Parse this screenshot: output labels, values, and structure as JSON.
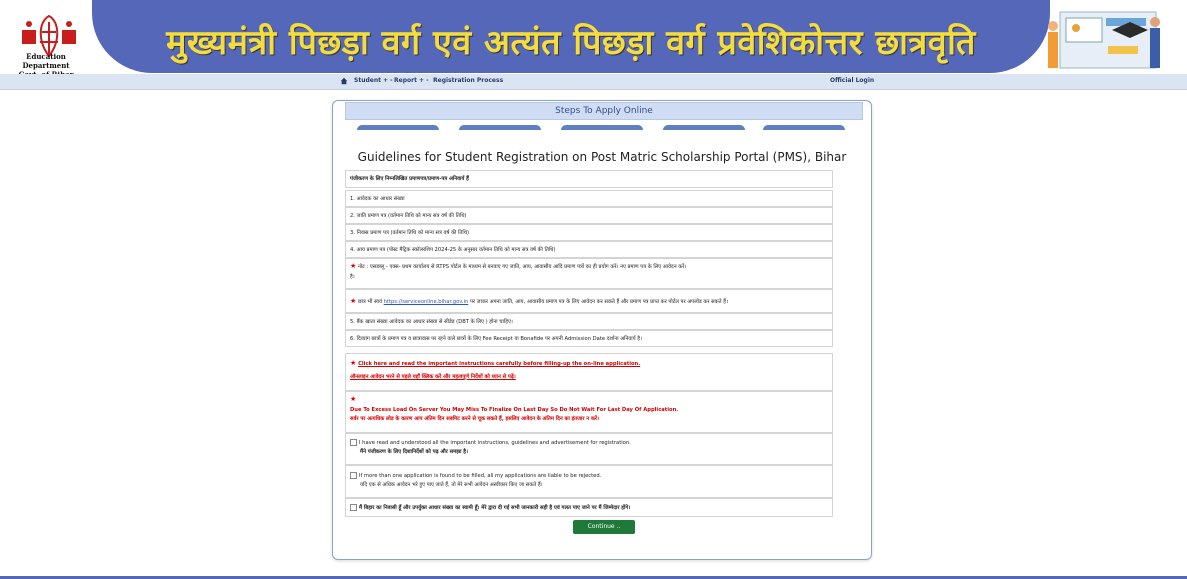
{
  "header": {
    "title": "मुख्यमंत्री पिछड़ा वर्ग एवं अत्यंत पिछड़ा वर्ग प्रवेशिकोत्तर छात्रवृति",
    "dept_line1": "Education Department",
    "dept_line2": "Govt. of Bihar"
  },
  "nav": {
    "student": "Student + -",
    "report": "Report + -",
    "registration": "Registration Process",
    "login": "Official Login"
  },
  "steps": {
    "title": "Steps To Apply Online"
  },
  "guidelines": {
    "title": "Guidelines for Student Registration on Post Matric Scholarship Portal (PMS), Bihar",
    "rows": [
      "पंजीकरण के लिए निम्नलिखित प्रमाणपत्र/प्रमाण-पत्र अनिवार्य हैं",
      "1. आवेदक का आधार संख्या",
      "2. जाति प्रमाण पत्र (वर्तमान तिथि को मान्य सत्र वर्ष की तिथि)",
      "3. निवास प्रमाण पत्र (वर्तमान तिथि को मान्य सत्र वर्ष की तिथि)",
      "4. आय प्रमाण पत्र (पोस्ट मैट्रिक स्कॉलरशिप 2024-25 के अनुसार वर्तमान तिथि को मान्य सत्र वर्ष की तिथि)"
    ],
    "note1": "नोट : एसडब्लू - एक्स- प्रथम कार्यालय से RTPS पोर्टल के माध्यम से बनवाए गए जाति, आय, आवासीय आदि प्रमाण पत्रों का ही प्रयोग करें। नए प्रमाण पत्र के लिए आवेदन करें।",
    "note1b": "है।",
    "note2_pre": "छात्र भी स्वयं",
    "note2_link": "https://serviceonline.bihar.gov.in",
    "note2_post": "पर जाकर अपना जाति, आय, आवासीय प्रमाण पत्र के लिए आवेदन कर सकते हैं और प्रमाण पत्र प्राप्त कर पोर्टल पर अपलोड कर सकते हैं।",
    "row5": "5. बैंक खाता संख्या आवेदक का आधार संख्या से सीडेड (DBT के लिए ) होना चाहिए।",
    "row6": "6. दिव्यांग छात्रों के प्रमाण पत्र व छात्रावास पर रहने वाले छात्रों के लिए Fee Receipt या Bonafide पर अपनी Admission Date दर्शाना अनिवार्य है।"
  },
  "instructions": {
    "click_here": "Click here and read the important instructions carefully before filling-up the on-line application.",
    "hindi_read": "ऑनलाइन आवेदन भरने से पहले यहाँ क्लिक करें और महत्वपूर्ण निर्देशों को ध्यान से पढ़ें।",
    "server_warning": "Due To Excess Load On Server You May Miss To Finalize On Last Day So Do Not Wait For Last Day Of Application.",
    "server_warning_hi": "सर्वर पर अत्यधिक लोड के कारण आप अंतिम दिन सबमिट करने से चूक सकते हैं, इसलिए आवेदन के अंतिम दिन का इंतजार न करें।"
  },
  "checks": {
    "c1_en": "I have read and understood all the important instructions, guidelines and advertisement for registration.",
    "c1_hi": "मैंने पंजीकरण के लिए दिशानिर्देशों को पढ़ और समझा है।",
    "c2_en": "If more than one application is found to be filled, all my applications are liable to be rejected.",
    "c2_hi": "यदि एक से अधिक आवेदन भरे हुए पाए जाते हैं, तो मेरे सभी आवेदन अस्वीकार किए जा सकते हैं।",
    "c3": "मैं बिहार का निवासी हूँ और उपर्युक्त आधार संख्या का स्वामी हूँ। मेरे द्वारा दी गई सभी जानकारी सही है एवं गलत पाए जाने पर मैं जिम्मेदार होंगे।"
  },
  "buttons": {
    "continue": "Continue .."
  }
}
